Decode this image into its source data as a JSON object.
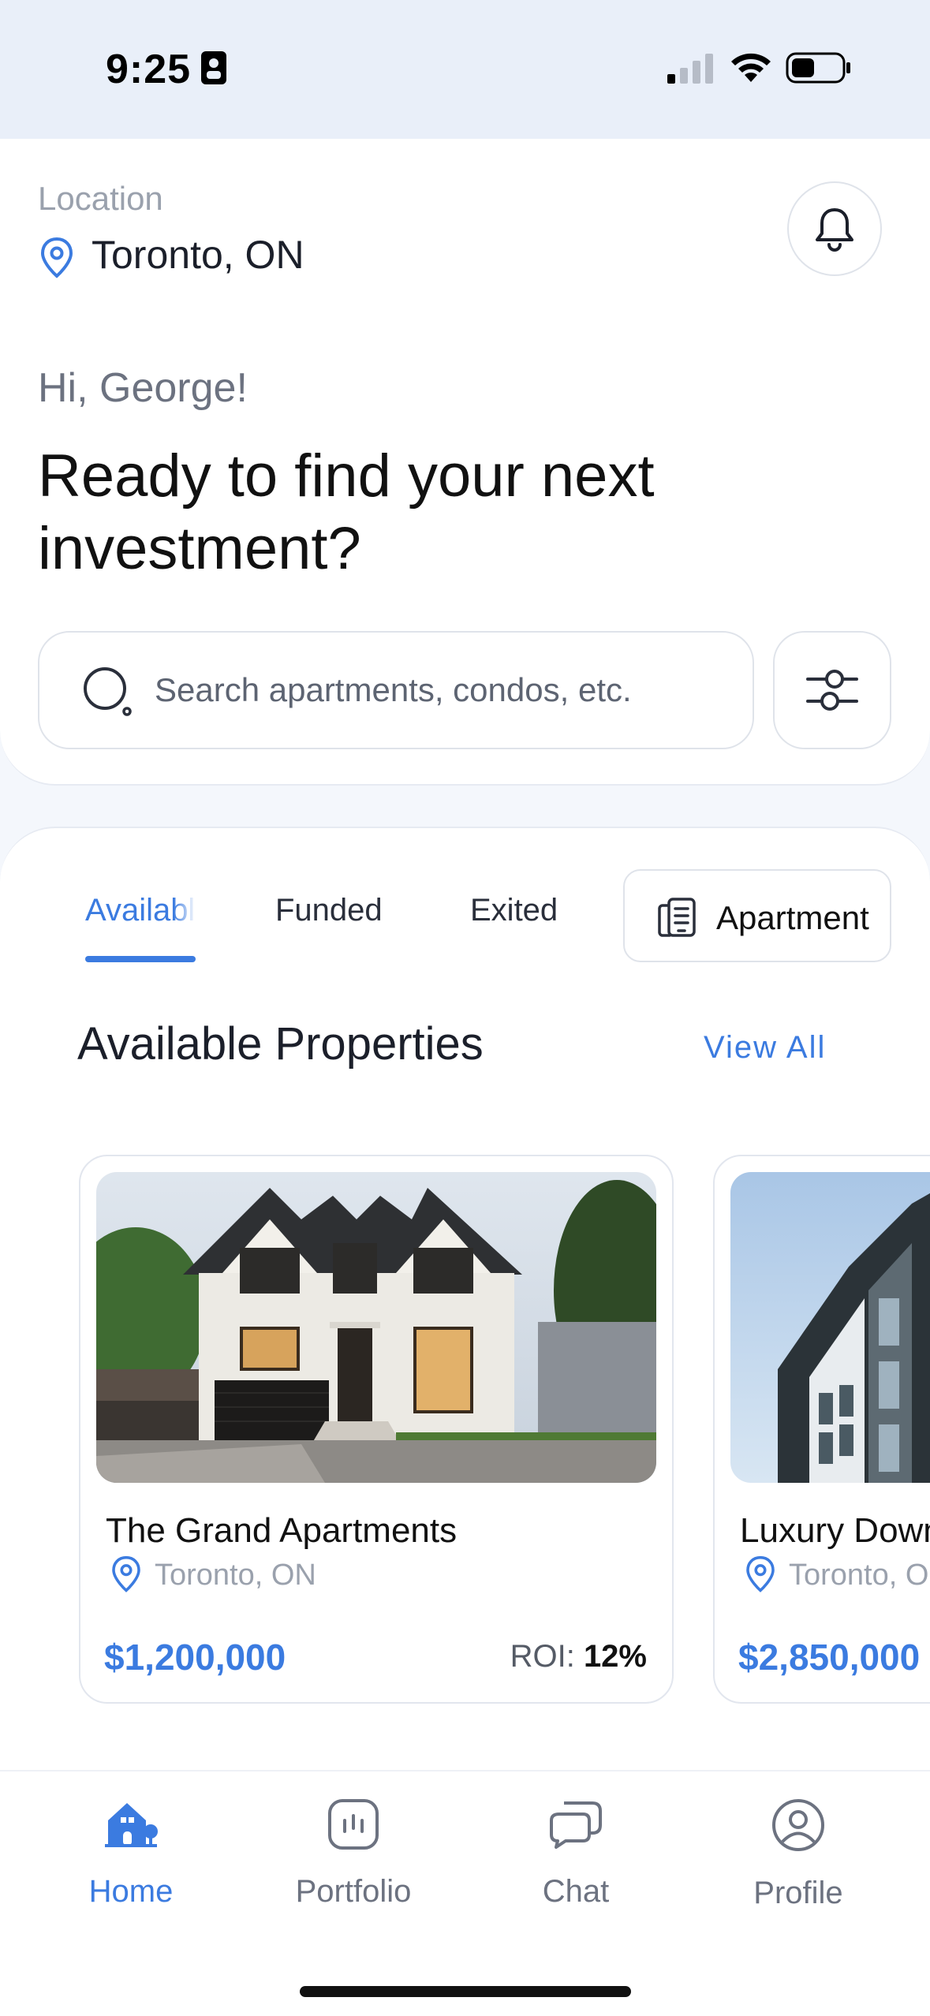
{
  "status_bar": {
    "time": "9:25"
  },
  "header": {
    "location_label": "Location",
    "location_city": "Toronto, ON",
    "greeting": "Hi, George!",
    "headline": "Ready to find your next investment?"
  },
  "search": {
    "placeholder": "Search apartments, condos, etc."
  },
  "tabs": [
    {
      "label": "Available",
      "active": true
    },
    {
      "label": "Funded",
      "active": false
    },
    {
      "label": "Exited",
      "active": false
    }
  ],
  "type_filter": {
    "label": "Apartment",
    "icon": "building-icon"
  },
  "section": {
    "title": "Available Properties",
    "view_all": "View All"
  },
  "properties": [
    {
      "name": "The Grand Apartments",
      "city": "Toronto, ON",
      "price": "$1,200,000",
      "roi_label": "ROI:",
      "roi_value": "12%"
    },
    {
      "name": "Luxury Down",
      "city": "Toronto, ON",
      "price": "$2,850,000"
    }
  ],
  "bottom_nav": [
    {
      "label": "Home",
      "icon": "home-icon",
      "active": true
    },
    {
      "label": "Portfolio",
      "icon": "portfolio-icon",
      "active": false
    },
    {
      "label": "Chat",
      "icon": "chat-icon",
      "active": false
    },
    {
      "label": "Profile",
      "icon": "profile-icon",
      "active": false
    }
  ],
  "colors": {
    "accent": "#3b7be0",
    "status_bg": "#e9eff9",
    "muted": "#9aa1ad"
  }
}
